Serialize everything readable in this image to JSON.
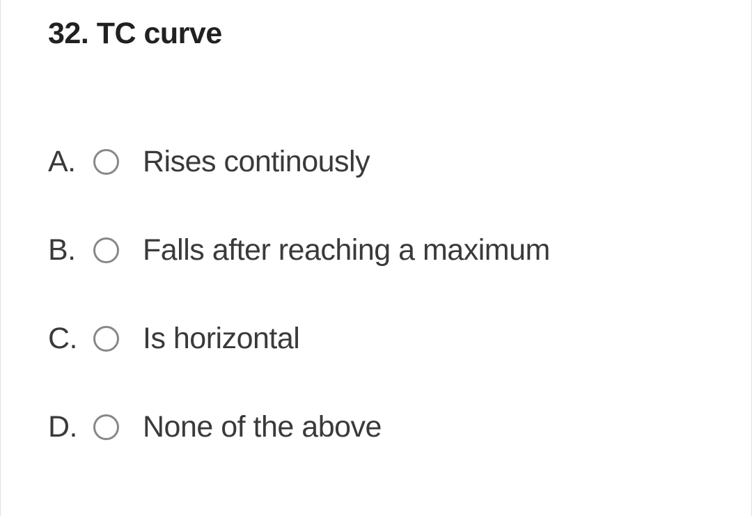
{
  "question": {
    "number": "32.",
    "text": "TC curve",
    "options": [
      {
        "letter": "A.",
        "text": "Rises continously"
      },
      {
        "letter": "B.",
        "text": "Falls after reaching a maximum"
      },
      {
        "letter": "C.",
        "text": "Is horizontal"
      },
      {
        "letter": "D.",
        "text": "None of the above"
      }
    ]
  }
}
